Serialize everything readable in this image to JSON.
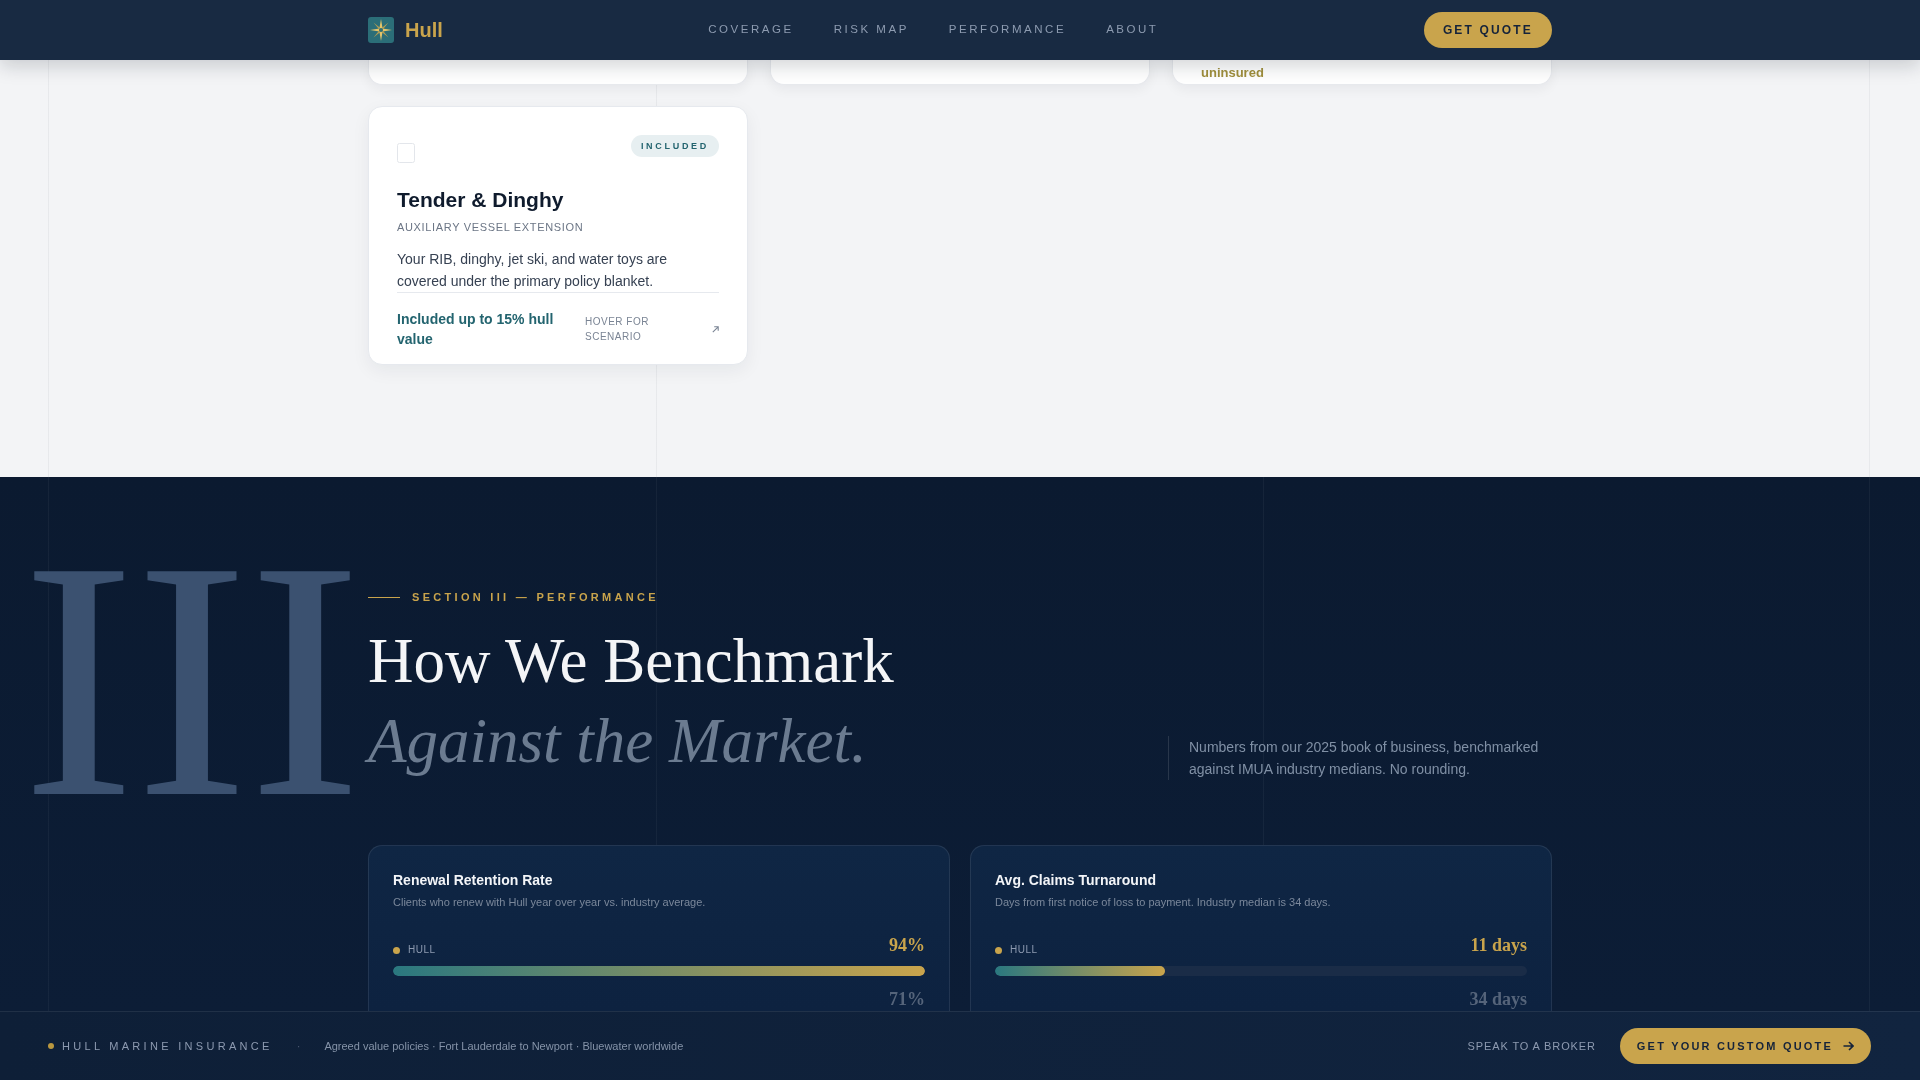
{
  "nav": {
    "brand": "Hull",
    "links": [
      {
        "label": "COVERAGE"
      },
      {
        "label": "RISK MAP"
      },
      {
        "label": "PERFORMANCE"
      },
      {
        "label": "ABOUT"
      }
    ],
    "cta": "GET QUOTE"
  },
  "cut_cards": [
    {
      "kind": "blank"
    },
    {
      "kind": "blank"
    },
    {
      "kind": "text",
      "text": "uninsured"
    }
  ],
  "coverage_card": {
    "badge": "INCLUDED",
    "title": "Tender & Dinghy",
    "subtitle": "AUXILIARY VESSEL EXTENSION",
    "description": "Your RIB, dinghy, jet ski, and water toys are covered under the primary policy blanket.",
    "value": "Included up to 15% hull value",
    "hint": "HOVER FOR SCENARIO"
  },
  "performance": {
    "numeral": "III",
    "eyebrow": "SECTION III — PERFORMANCE",
    "title": "How We Benchmark",
    "title_accent": "Against the Market.",
    "intro": "Numbers from our 2025 book of business, benchmarked against IMUA industry medians. No rounding.",
    "metrics": [
      {
        "title": "Renewal Retention Rate",
        "description": "Clients who renew with Hull year over year vs. industry average.",
        "series": "HULL",
        "value": "94%",
        "level": 1,
        "comparison_value": "71%"
      },
      {
        "title": "Avg. Claims Turnaround",
        "description": "Days from first notice of loss to payment. Industry median is 34 days.",
        "series": "HULL",
        "value": "11 days",
        "level": 0.32,
        "comparison_value": "34 days"
      }
    ]
  },
  "footer": {
    "brand": "HULL MARINE INSURANCE",
    "separator": "·",
    "tagline": "Agreed value policies · Fort Lauderdale to Newport · Bluewater worldwide",
    "link": "SPEAK TO A BROKER",
    "cta": "GET YOUR CUSTOM QUOTE"
  }
}
